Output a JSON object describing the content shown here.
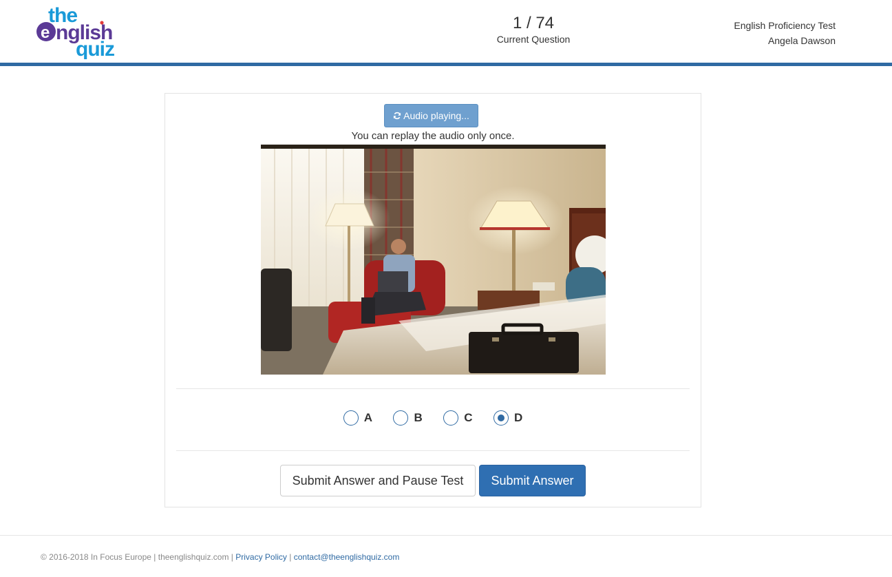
{
  "header": {
    "logo": {
      "line1": "the",
      "line2": "english",
      "line3": "quiz"
    },
    "progress": {
      "count": "1 / 74",
      "caption": "Current Question"
    },
    "test_name": "English Proficiency Test",
    "user_name": "Angela Dawson"
  },
  "question": {
    "audio_button_label": "Audio playing...",
    "replay_note": "You can replay the audio only once.",
    "choices": [
      "A",
      "B",
      "C",
      "D"
    ],
    "selected_choice": "D"
  },
  "actions": {
    "pause_label": "Submit Answer and Pause Test",
    "submit_label": "Submit Answer"
  },
  "footer": {
    "copyright": "© 2016-2018 In Focus Europe | theenglishquiz.com | ",
    "privacy_link": "Privacy Policy",
    "separator": " | ",
    "contact_link": "contact@theenglishquiz.com"
  },
  "colors": {
    "brand_blue": "#2f6aa3",
    "logo_blue": "#1a9ad8",
    "logo_purple": "#5b3a96",
    "primary_button": "#2f6fb2",
    "audio_button": "#6fa0cf"
  },
  "icons": {
    "audio_button": "refresh-icon"
  }
}
